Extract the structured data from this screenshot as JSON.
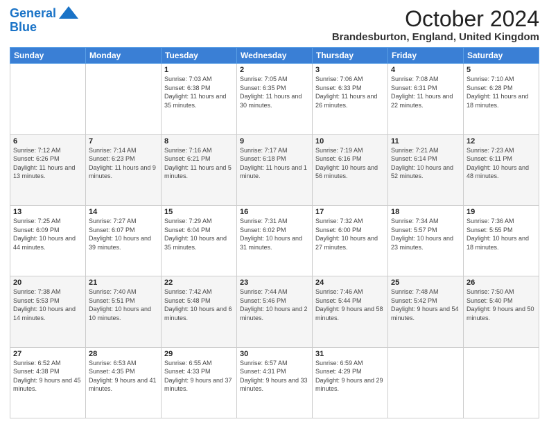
{
  "logo": {
    "line1": "General",
    "line2": "Blue"
  },
  "title": "October 2024",
  "location": "Brandesburton, England, United Kingdom",
  "days_header": [
    "Sunday",
    "Monday",
    "Tuesday",
    "Wednesday",
    "Thursday",
    "Friday",
    "Saturday"
  ],
  "weeks": [
    [
      {
        "day": "",
        "sunrise": "",
        "sunset": "",
        "daylight": ""
      },
      {
        "day": "",
        "sunrise": "",
        "sunset": "",
        "daylight": ""
      },
      {
        "day": "1",
        "sunrise": "Sunrise: 7:03 AM",
        "sunset": "Sunset: 6:38 PM",
        "daylight": "Daylight: 11 hours and 35 minutes."
      },
      {
        "day": "2",
        "sunrise": "Sunrise: 7:05 AM",
        "sunset": "Sunset: 6:35 PM",
        "daylight": "Daylight: 11 hours and 30 minutes."
      },
      {
        "day": "3",
        "sunrise": "Sunrise: 7:06 AM",
        "sunset": "Sunset: 6:33 PM",
        "daylight": "Daylight: 11 hours and 26 minutes."
      },
      {
        "day": "4",
        "sunrise": "Sunrise: 7:08 AM",
        "sunset": "Sunset: 6:31 PM",
        "daylight": "Daylight: 11 hours and 22 minutes."
      },
      {
        "day": "5",
        "sunrise": "Sunrise: 7:10 AM",
        "sunset": "Sunset: 6:28 PM",
        "daylight": "Daylight: 11 hours and 18 minutes."
      }
    ],
    [
      {
        "day": "6",
        "sunrise": "Sunrise: 7:12 AM",
        "sunset": "Sunset: 6:26 PM",
        "daylight": "Daylight: 11 hours and 13 minutes."
      },
      {
        "day": "7",
        "sunrise": "Sunrise: 7:14 AM",
        "sunset": "Sunset: 6:23 PM",
        "daylight": "Daylight: 11 hours and 9 minutes."
      },
      {
        "day": "8",
        "sunrise": "Sunrise: 7:16 AM",
        "sunset": "Sunset: 6:21 PM",
        "daylight": "Daylight: 11 hours and 5 minutes."
      },
      {
        "day": "9",
        "sunrise": "Sunrise: 7:17 AM",
        "sunset": "Sunset: 6:18 PM",
        "daylight": "Daylight: 11 hours and 1 minute."
      },
      {
        "day": "10",
        "sunrise": "Sunrise: 7:19 AM",
        "sunset": "Sunset: 6:16 PM",
        "daylight": "Daylight: 10 hours and 56 minutes."
      },
      {
        "day": "11",
        "sunrise": "Sunrise: 7:21 AM",
        "sunset": "Sunset: 6:14 PM",
        "daylight": "Daylight: 10 hours and 52 minutes."
      },
      {
        "day": "12",
        "sunrise": "Sunrise: 7:23 AM",
        "sunset": "Sunset: 6:11 PM",
        "daylight": "Daylight: 10 hours and 48 minutes."
      }
    ],
    [
      {
        "day": "13",
        "sunrise": "Sunrise: 7:25 AM",
        "sunset": "Sunset: 6:09 PM",
        "daylight": "Daylight: 10 hours and 44 minutes."
      },
      {
        "day": "14",
        "sunrise": "Sunrise: 7:27 AM",
        "sunset": "Sunset: 6:07 PM",
        "daylight": "Daylight: 10 hours and 39 minutes."
      },
      {
        "day": "15",
        "sunrise": "Sunrise: 7:29 AM",
        "sunset": "Sunset: 6:04 PM",
        "daylight": "Daylight: 10 hours and 35 minutes."
      },
      {
        "day": "16",
        "sunrise": "Sunrise: 7:31 AM",
        "sunset": "Sunset: 6:02 PM",
        "daylight": "Daylight: 10 hours and 31 minutes."
      },
      {
        "day": "17",
        "sunrise": "Sunrise: 7:32 AM",
        "sunset": "Sunset: 6:00 PM",
        "daylight": "Daylight: 10 hours and 27 minutes."
      },
      {
        "day": "18",
        "sunrise": "Sunrise: 7:34 AM",
        "sunset": "Sunset: 5:57 PM",
        "daylight": "Daylight: 10 hours and 23 minutes."
      },
      {
        "day": "19",
        "sunrise": "Sunrise: 7:36 AM",
        "sunset": "Sunset: 5:55 PM",
        "daylight": "Daylight: 10 hours and 18 minutes."
      }
    ],
    [
      {
        "day": "20",
        "sunrise": "Sunrise: 7:38 AM",
        "sunset": "Sunset: 5:53 PM",
        "daylight": "Daylight: 10 hours and 14 minutes."
      },
      {
        "day": "21",
        "sunrise": "Sunrise: 7:40 AM",
        "sunset": "Sunset: 5:51 PM",
        "daylight": "Daylight: 10 hours and 10 minutes."
      },
      {
        "day": "22",
        "sunrise": "Sunrise: 7:42 AM",
        "sunset": "Sunset: 5:48 PM",
        "daylight": "Daylight: 10 hours and 6 minutes."
      },
      {
        "day": "23",
        "sunrise": "Sunrise: 7:44 AM",
        "sunset": "Sunset: 5:46 PM",
        "daylight": "Daylight: 10 hours and 2 minutes."
      },
      {
        "day": "24",
        "sunrise": "Sunrise: 7:46 AM",
        "sunset": "Sunset: 5:44 PM",
        "daylight": "Daylight: 9 hours and 58 minutes."
      },
      {
        "day": "25",
        "sunrise": "Sunrise: 7:48 AM",
        "sunset": "Sunset: 5:42 PM",
        "daylight": "Daylight: 9 hours and 54 minutes."
      },
      {
        "day": "26",
        "sunrise": "Sunrise: 7:50 AM",
        "sunset": "Sunset: 5:40 PM",
        "daylight": "Daylight: 9 hours and 50 minutes."
      }
    ],
    [
      {
        "day": "27",
        "sunrise": "Sunrise: 6:52 AM",
        "sunset": "Sunset: 4:38 PM",
        "daylight": "Daylight: 9 hours and 45 minutes."
      },
      {
        "day": "28",
        "sunrise": "Sunrise: 6:53 AM",
        "sunset": "Sunset: 4:35 PM",
        "daylight": "Daylight: 9 hours and 41 minutes."
      },
      {
        "day": "29",
        "sunrise": "Sunrise: 6:55 AM",
        "sunset": "Sunset: 4:33 PM",
        "daylight": "Daylight: 9 hours and 37 minutes."
      },
      {
        "day": "30",
        "sunrise": "Sunrise: 6:57 AM",
        "sunset": "Sunset: 4:31 PM",
        "daylight": "Daylight: 9 hours and 33 minutes."
      },
      {
        "day": "31",
        "sunrise": "Sunrise: 6:59 AM",
        "sunset": "Sunset: 4:29 PM",
        "daylight": "Daylight: 9 hours and 29 minutes."
      },
      {
        "day": "",
        "sunrise": "",
        "sunset": "",
        "daylight": ""
      },
      {
        "day": "",
        "sunrise": "",
        "sunset": "",
        "daylight": ""
      }
    ]
  ]
}
